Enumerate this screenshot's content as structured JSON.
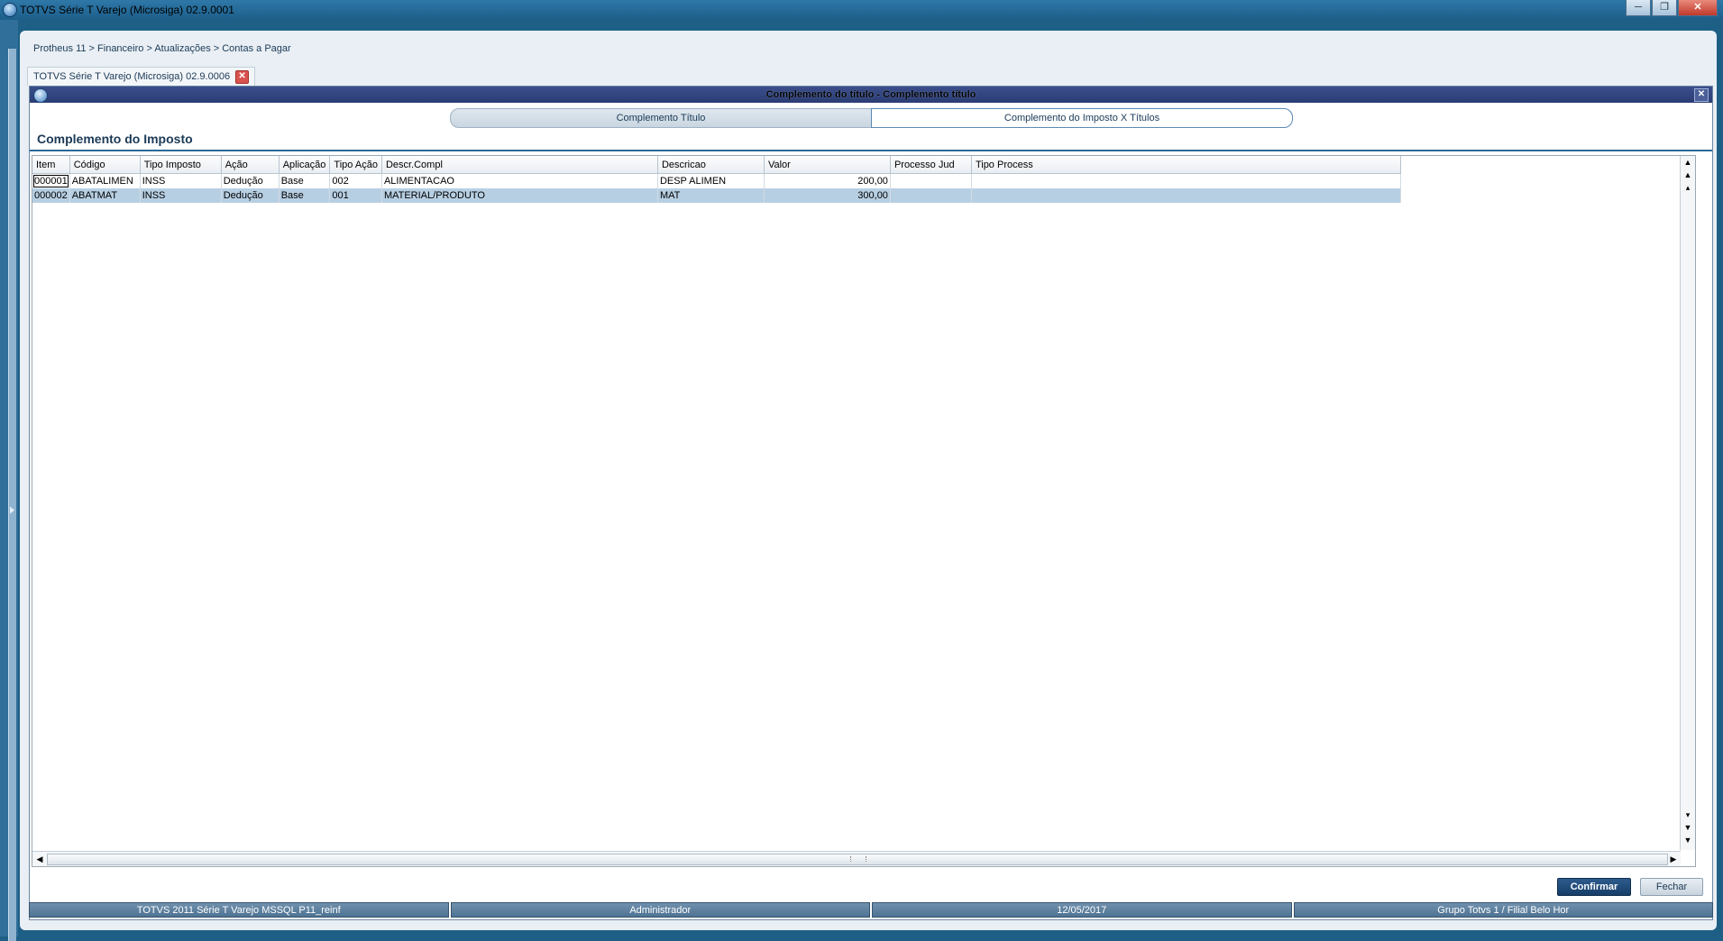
{
  "window": {
    "title": "TOTVS Série T Varejo (Microsiga) 02.9.0001",
    "controls": [
      "minimize",
      "restore",
      "close"
    ]
  },
  "breadcrumb": "Protheus 11 > Financeiro > Atualizações > Contas a Pagar",
  "app_tab": {
    "label": "TOTVS Série T Varejo (Microsiga) 02.9.0006"
  },
  "dialog": {
    "title": "Complemento do título - Complemento título",
    "folders": [
      "Complemento Título",
      "Complemento do Imposto X Títulos"
    ],
    "active_folder": 1,
    "section_title": "Complemento do Imposto"
  },
  "grid": {
    "columns": [
      "Item",
      "Código",
      "Tipo Imposto",
      "Ação",
      "Aplicação",
      "Tipo Ação",
      "Descr.Compl",
      "Descricao",
      "Valor",
      "Processo Jud",
      "Tipo Process"
    ],
    "rows": [
      [
        "000001",
        "ABATALIMEN",
        "INSS",
        "Dedução",
        "Base",
        "002",
        "ALIMENTACAO",
        "DESP ALIMEN",
        "200,00",
        "",
        ""
      ],
      [
        "000002",
        "ABATMAT",
        "INSS",
        "Dedução",
        "Base",
        "001",
        "MATERIAL/PRODUTO",
        "MAT",
        "300,00",
        "",
        ""
      ]
    ],
    "selected_row": 1
  },
  "buttons": {
    "confirm": "Confirmar",
    "close": "Fechar"
  },
  "statusbar": [
    "TOTVS 2011 Série T Varejo MSSQL P11_reinf",
    "Administrador",
    "12/05/2017",
    "Grupo Totvs 1 / Filial Belo Hor"
  ],
  "colors": {
    "titlebar": "#2e78a8",
    "dialog_title": "#2b3c73",
    "selected_row": "#b7cfe3",
    "confirm_button": "#163e68",
    "statusbar": "#4f7393"
  }
}
